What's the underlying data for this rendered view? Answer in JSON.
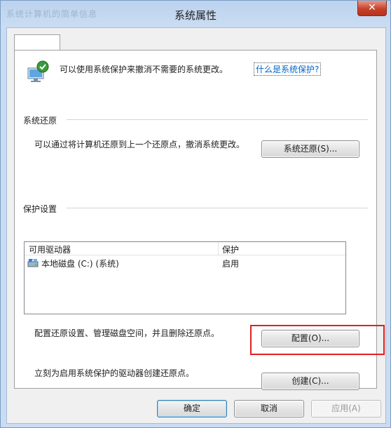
{
  "window": {
    "title": "系统属性",
    "faded_title": "系统计算机的简单信息",
    "close_glyph": "✕"
  },
  "protection": {
    "intro": "可以使用系统保护来撤消不需要的系统更改。",
    "link": "什么是系统保护?"
  },
  "restore": {
    "section_label": "系统还原",
    "description": "可以通过将计算机还原到上一个还原点，撤消系统更改。",
    "button": "系统还原(S)..."
  },
  "settings": {
    "section_label": "保护设置",
    "columns": [
      "可用驱动器",
      "保护"
    ],
    "rows": [
      {
        "drive": "本地磁盘 (C:) (系统)",
        "protection": "启用"
      }
    ],
    "configure_text": "配置还原设置、管理磁盘空间，并且删除还原点。",
    "configure_button": "配置(O)...",
    "create_text": "立刻为启用系统保护的驱动器创建还原点。",
    "create_button": "创建(C)..."
  },
  "footer": {
    "ok": "确定",
    "cancel": "取消",
    "apply": "应用(A)"
  },
  "colors": {
    "highlight_border": "#e02020",
    "link": "#0066cc"
  }
}
